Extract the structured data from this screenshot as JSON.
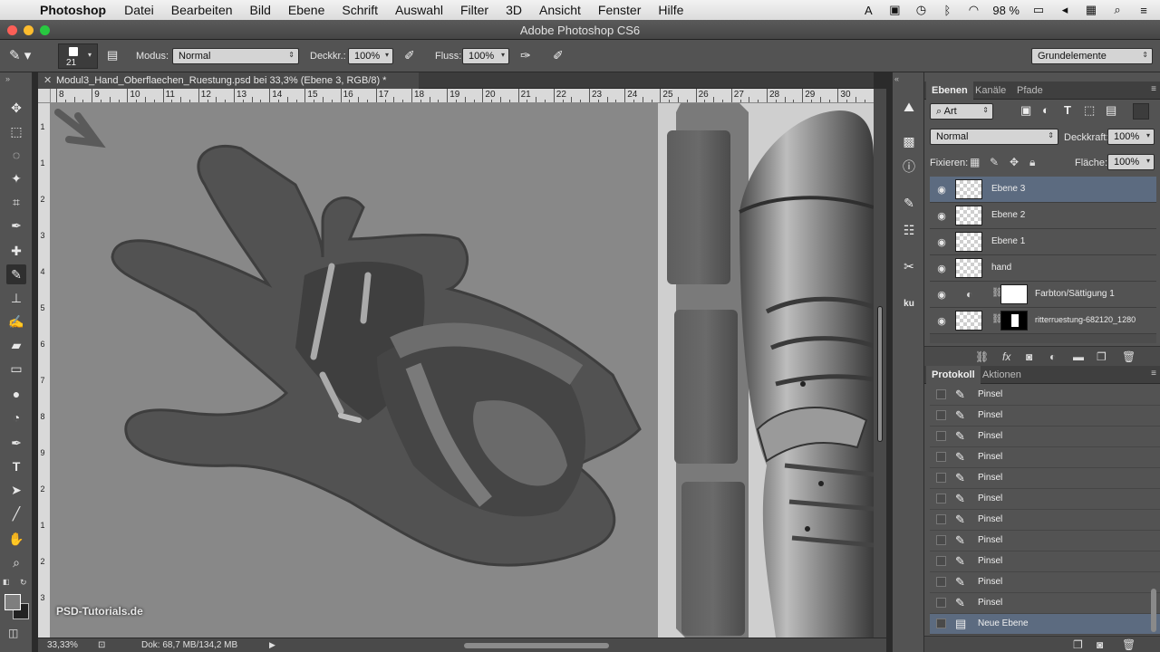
{
  "menubar": {
    "app": "Photoshop",
    "items": [
      "Datei",
      "Bearbeiten",
      "Bild",
      "Ebene",
      "Schrift",
      "Auswahl",
      "Filter",
      "3D",
      "Ansicht",
      "Fenster",
      "Hilfe"
    ],
    "battery": "98 %"
  },
  "window": {
    "title": "Adobe Photoshop CS6"
  },
  "options": {
    "brush_size": "21",
    "mode_label": "Modus:",
    "mode_value": "Normal",
    "opacity_label": "Deckkr.:",
    "opacity_value": "100%",
    "flow_label": "Fluss:",
    "flow_value": "100%",
    "workspace": "Grundelemente"
  },
  "document": {
    "tab_title": "Modul3_Hand_Oberflaechen_Ruestung.psd bei 33,3% (Ebene 3, RGB/8) *",
    "ruler_h": [
      "8",
      "9",
      "10",
      "11",
      "12",
      "13",
      "14",
      "15",
      "16",
      "17",
      "18",
      "19",
      "20",
      "21",
      "22",
      "23",
      "24",
      "25",
      "26",
      "27",
      "28",
      "29",
      "30"
    ],
    "ruler_v": [
      "1",
      "1",
      "2",
      "3",
      "4",
      "5",
      "6",
      "7",
      "8",
      "9",
      "2",
      "1",
      "2",
      "3"
    ]
  },
  "status": {
    "zoom": "33,33%",
    "doc": "Dok: 68,7 MB/134,2 MB",
    "watermark": "PSD-Tutorials.de"
  },
  "layers_panel": {
    "tabs": [
      "Ebenen",
      "Kanäle",
      "Pfade"
    ],
    "filter_kind": "Art",
    "blend_mode": "Normal",
    "opacity_label": "Deckkraft:",
    "opacity_value": "100%",
    "lock_label": "Fixieren:",
    "fill_label": "Fläche:",
    "fill_value": "100%",
    "layers": [
      {
        "name": "Ebene 3"
      },
      {
        "name": "Ebene 2"
      },
      {
        "name": "Ebene 1"
      },
      {
        "name": "hand"
      },
      {
        "name": "Farbton/Sättigung 1"
      },
      {
        "name": "ritterruestung-682120_1280"
      }
    ]
  },
  "history_panel": {
    "tabs": [
      "Protokoll",
      "Aktionen"
    ],
    "items": [
      {
        "label": "Pinsel",
        "icon": "brush-icon"
      },
      {
        "label": "Pinsel",
        "icon": "brush-icon"
      },
      {
        "label": "Pinsel",
        "icon": "brush-icon"
      },
      {
        "label": "Pinsel",
        "icon": "brush-icon"
      },
      {
        "label": "Pinsel",
        "icon": "brush-icon"
      },
      {
        "label": "Pinsel",
        "icon": "brush-icon"
      },
      {
        "label": "Pinsel",
        "icon": "brush-icon"
      },
      {
        "label": "Pinsel",
        "icon": "brush-icon"
      },
      {
        "label": "Pinsel",
        "icon": "brush-icon"
      },
      {
        "label": "Pinsel",
        "icon": "brush-icon"
      },
      {
        "label": "Pinsel",
        "icon": "brush-icon"
      },
      {
        "label": "Neue Ebene",
        "icon": "new-layer-icon"
      }
    ]
  },
  "colors": {
    "accent_selected": "#5c6b80",
    "panel": "#535353",
    "canvas_bg": "#8a8a8a"
  }
}
